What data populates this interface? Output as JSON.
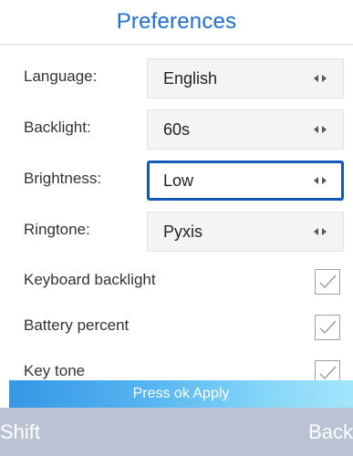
{
  "header": {
    "title": "Preferences",
    "title_color": "#1f6fcf"
  },
  "settings": [
    {
      "label": "Language:",
      "value": "English",
      "icon": "left-right-arrows-icon"
    },
    {
      "label": "Backlight:",
      "value": "60s",
      "icon": "left-right-arrows-icon"
    },
    {
      "label": "Brightness:",
      "value": "Low",
      "icon": "left-right-arrows-icon",
      "focused": true
    },
    {
      "label": "Ringtone:",
      "value": "Pyxis",
      "icon": "left-right-arrows-icon"
    }
  ],
  "toggles": [
    {
      "label": "Keyboard backlight",
      "checked": true
    },
    {
      "label": "Battery percent",
      "checked": true
    },
    {
      "label": "Key tone",
      "checked": true
    }
  ],
  "hint": {
    "text": "Press ok Apply"
  },
  "softkeys": {
    "left": "Shift",
    "right": "Back"
  },
  "colors": {
    "accent": "#1f6fcf",
    "focus_border": "#1459b8",
    "hint_gradient_start": "#3497e6",
    "hint_gradient_end": "#a3e6fb",
    "softkey_bar": "#b9c3d4"
  }
}
